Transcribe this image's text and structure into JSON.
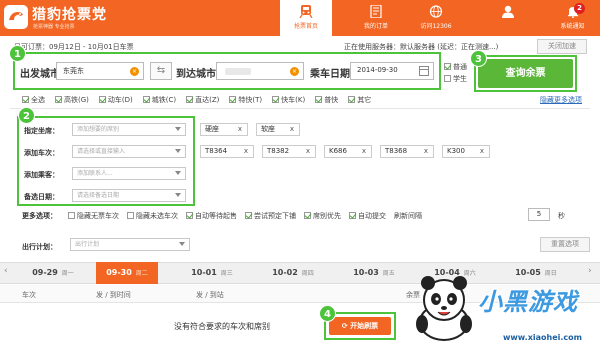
{
  "header": {
    "app_name": "猎豹抢票党",
    "app_tagline": "抢票神器 专业抢票",
    "tabs": [
      {
        "label": "抢票首页",
        "icon": "train-icon"
      },
      {
        "label": "我的订单",
        "icon": "order-icon"
      },
      {
        "label": "访问12306",
        "icon": "globe-icon"
      },
      {
        "label": "",
        "icon": "user-icon"
      },
      {
        "label": "系统通知",
        "icon": "bell-icon"
      }
    ],
    "notification_count": "2",
    "brand_color": "#f26522"
  },
  "info_bar": {
    "presale": "日可订票：09月12日 - 10月01日车票",
    "server_status": "正在使用服务器：默认服务器 (延迟：正在测速...)",
    "close_accel": "关闭加速"
  },
  "query": {
    "from_label": "出发城市",
    "from_value": "东莞东",
    "to_label": "到达城市",
    "date_label": "乘车日期",
    "date_value": "2014-09-30",
    "passenger_normal": "普通",
    "passenger_student": "学生",
    "button": "查询余票",
    "highlight_color": "#4cc33a"
  },
  "badges": [
    "1",
    "2",
    "3",
    "4"
  ],
  "train_types": {
    "items": [
      {
        "label": "全选",
        "checked": true
      },
      {
        "label": "高铁(G)",
        "checked": true
      },
      {
        "label": "动车(D)",
        "checked": true
      },
      {
        "label": "城铁(C)",
        "checked": true
      },
      {
        "label": "直达(Z)",
        "checked": true
      },
      {
        "label": "特快(T)",
        "checked": true
      },
      {
        "label": "快车(K)",
        "checked": true
      },
      {
        "label": "普快",
        "checked": true
      },
      {
        "label": "其它",
        "checked": true
      }
    ],
    "hide_more": "隐藏更多选项"
  },
  "filters": {
    "seat_label": "指定坐席：",
    "seat_placeholder": "添加想要的席别",
    "train_label": "添加车次：",
    "train_placeholder": "请选择或直接输入",
    "passenger_label": "添加乘客：",
    "passenger_placeholder": "添加联系人...",
    "backup_date_label": "备选日期：",
    "backup_date_placeholder": "请选择备选日期",
    "seat_tags": [
      "硬座",
      "软座"
    ],
    "train_tags": [
      "T8364",
      "T8382",
      "K686",
      "T8368",
      "K300"
    ]
  },
  "more_options": {
    "label": "更多选项：",
    "items": [
      {
        "label": "隐藏无票车次",
        "checked": false
      },
      {
        "label": "隐藏未选车次",
        "checked": false
      },
      {
        "label": "自动等待起售",
        "checked": true
      },
      {
        "label": "尝试预定下铺",
        "checked": true
      },
      {
        "label": "席别优先",
        "checked": true
      },
      {
        "label": "自动提交",
        "checked": true
      }
    ],
    "refresh_label": "刷新间隔",
    "refresh_value": "5",
    "refresh_unit": "秒"
  },
  "plan": {
    "label": "出行计划：",
    "placeholder": "出行计划",
    "reset": "重置选项"
  },
  "dates": [
    {
      "date": "09-29",
      "weekday": "周一",
      "active": false
    },
    {
      "date": "09-30",
      "weekday": "周二",
      "active": true
    },
    {
      "date": "10-01",
      "weekday": "周三",
      "active": false
    },
    {
      "date": "10-02",
      "weekday": "周四",
      "active": false
    },
    {
      "date": "10-03",
      "weekday": "周五",
      "active": false
    },
    {
      "date": "10-04",
      "weekday": "周六",
      "active": false
    },
    {
      "date": "10-05",
      "weekday": "周日",
      "active": false
    }
  ],
  "columns": [
    "车次",
    "发 / 到时间",
    "发 / 到站",
    "余票"
  ],
  "results": {
    "empty_message": "没有符合要求的车次和席别",
    "grab_button": "开始刷票"
  },
  "watermark": {
    "text": "小黑游戏",
    "url": "www.xiaohei.com"
  }
}
